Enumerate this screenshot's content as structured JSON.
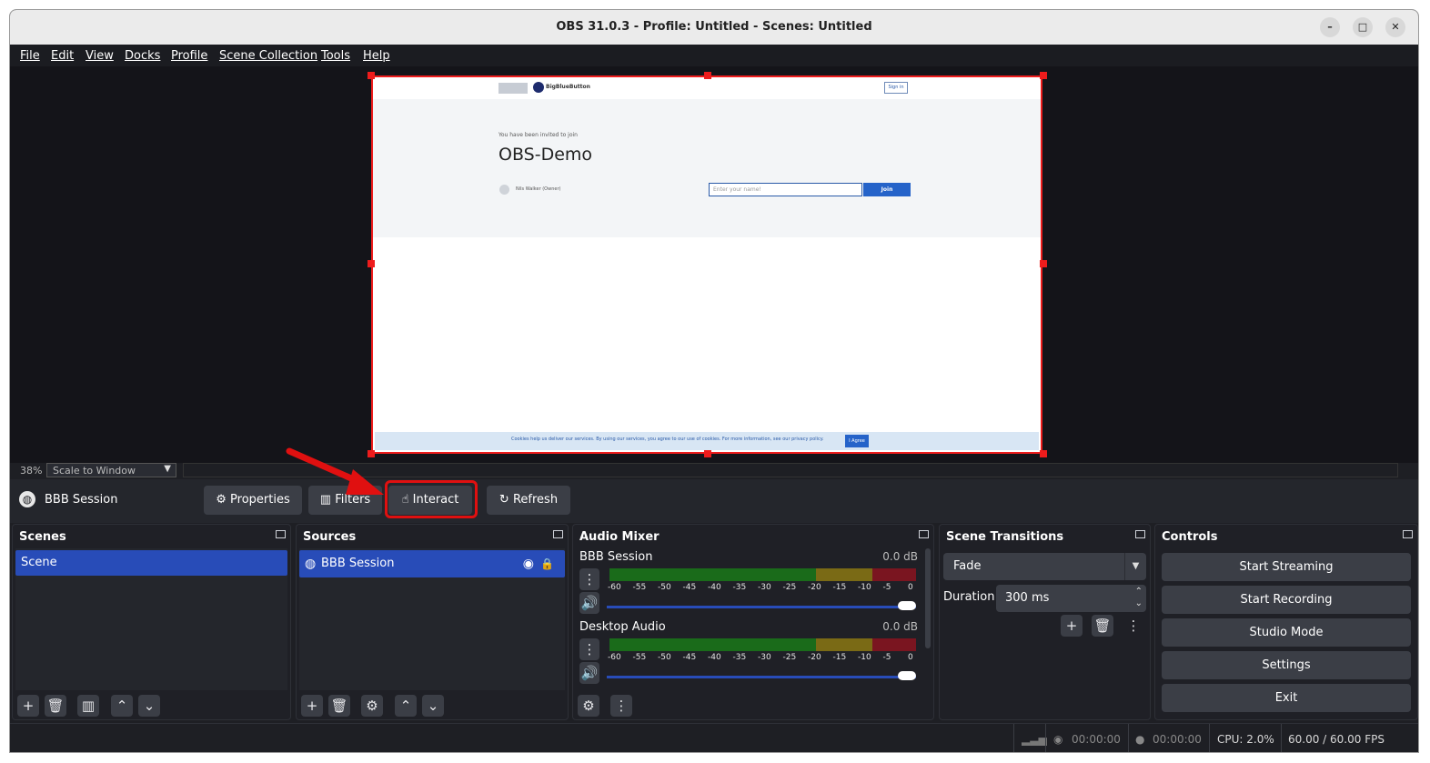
{
  "window": {
    "title": "OBS 31.0.3 - Profile: Untitled - Scenes: Untitled"
  },
  "menu": [
    "File",
    "Edit",
    "View",
    "Docks",
    "Profile",
    "Scene Collection",
    "Tools",
    "Help"
  ],
  "preview": {
    "invited": "You have been invited to join",
    "room": "OBS-Demo",
    "name_placeholder": "Enter your name!",
    "join": "Join",
    "signin": "Sign in",
    "logo": "BigBlueButton",
    "moderator": "Nils Walker (Owner)",
    "cookie": "Cookies help us deliver our services. By using our services, you agree to our use of cookies. For more information, see our privacy policy.",
    "cookie_btn": "I Agree"
  },
  "zoom": {
    "percent": "38%",
    "mode": "Scale to Window"
  },
  "source_toolbar": {
    "source": "BBB Session",
    "properties": "Properties",
    "filters": "Filters",
    "interact": "Interact",
    "refresh": "Refresh"
  },
  "scenes": {
    "title": "Scenes",
    "items": [
      "Scene"
    ]
  },
  "sources": {
    "title": "Sources",
    "items": [
      "BBB Session"
    ]
  },
  "audio_mixer": {
    "title": "Audio Mixer",
    "ticks": [
      "-60",
      "-55",
      "-50",
      "-45",
      "-40",
      "-35",
      "-30",
      "-25",
      "-20",
      "-15",
      "-10",
      "-5",
      "0"
    ],
    "channels": [
      {
        "name": "BBB Session",
        "db": "0.0 dB",
        "volume": 1.0
      },
      {
        "name": "Desktop Audio",
        "db": "0.0 dB",
        "volume": 1.0
      }
    ]
  },
  "transitions": {
    "title": "Scene Transitions",
    "type": "Fade",
    "duration_label": "Duration",
    "duration": "300 ms"
  },
  "controls": {
    "title": "Controls",
    "buttons": [
      "Start Streaming",
      "Start Recording",
      "Studio Mode",
      "Settings",
      "Exit"
    ]
  },
  "status": {
    "rec_time": "00:00:00",
    "stream_time": "00:00:00",
    "cpu": "CPU: 2.0%",
    "fps": "60.00 / 60.00 FPS"
  },
  "colors": {
    "accent": "#284cb8",
    "highlight": "#e01010"
  }
}
